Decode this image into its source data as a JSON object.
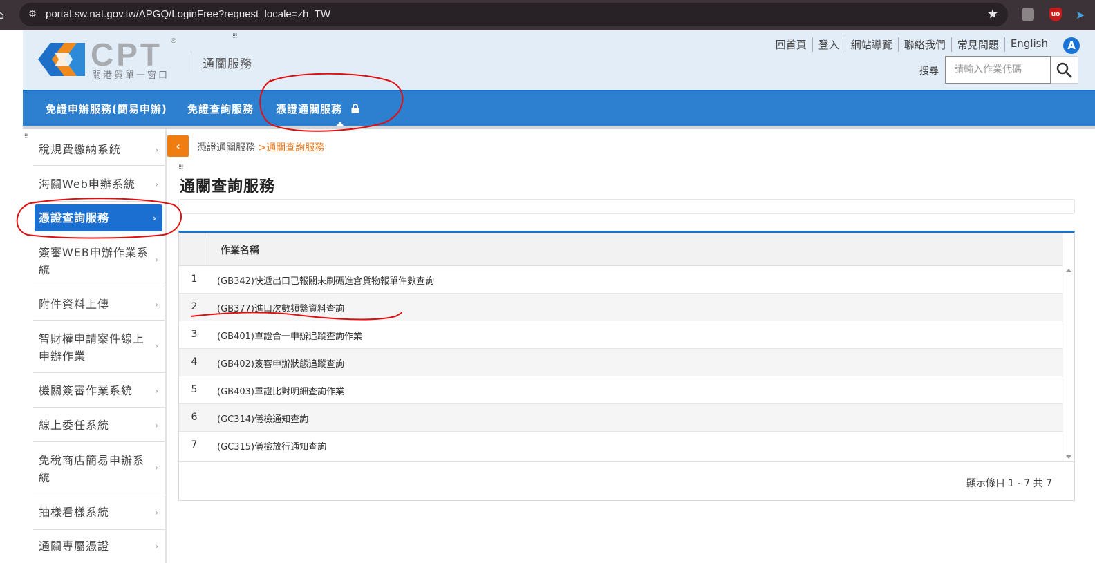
{
  "browser": {
    "url": "portal.sw.nat.gov.tw/APGQ/LoginFree?request_locale=zh_TW"
  },
  "header": {
    "logo_text": "CPT",
    "logo_reg": "®",
    "logo_sub": "關港貿單一窗口",
    "service_title": "通關服務",
    "top_links": [
      "回首頁",
      "登入",
      "網站導覽",
      "聯絡我們",
      "常見問題",
      "English"
    ],
    "access_icon": "A",
    "search_label": "搜尋",
    "search_placeholder": "請輸入作業代碼"
  },
  "main_nav": {
    "items": [
      "免證申辦服務(簡易申辦)",
      "免證查詢服務",
      "憑證通關服務"
    ],
    "active_index": 2
  },
  "sidebar": {
    "items": [
      {
        "label": "稅規費繳納系統"
      },
      {
        "label": "海關Web申辦系統"
      },
      {
        "label": "憑證查詢服務",
        "active": true
      },
      {
        "label": "簽審WEB申辦作業系統"
      },
      {
        "label": "附件資料上傳"
      },
      {
        "label": "智財權申請案件線上申辦作業"
      },
      {
        "label": "機關簽審作業系統"
      },
      {
        "label": "線上委任系統"
      },
      {
        "label": "免稅商店簡易申辦系統"
      },
      {
        "label": "抽樣看樣系統"
      },
      {
        "label": "通關專屬憑證"
      }
    ]
  },
  "breadcrumb": {
    "parent": "憑證通關服務",
    "separator": ">",
    "current": "通關查詢服務"
  },
  "page_title": "通關查詢服務",
  "grid": {
    "column_header": "作業名稱",
    "rows": [
      {
        "no": "1",
        "name": "(GB342)快遞出口已報關未刷碼進倉貨物報單件數查詢"
      },
      {
        "no": "2",
        "name": "(GB377)進口次數頻繁資料查詢"
      },
      {
        "no": "3",
        "name": "(GB401)單證合一申辦追蹤查詢作業"
      },
      {
        "no": "4",
        "name": "(GB402)簽審申辦狀態追蹤查詢"
      },
      {
        "no": "5",
        "name": "(GB403)單證比對明細查詢作業"
      },
      {
        "no": "6",
        "name": "(GC314)儀檢通知查詢"
      },
      {
        "no": "7",
        "name": "(GC315)儀檢放行通知查詢"
      }
    ],
    "pager_info": "顯示條目 1 - 7 共 7"
  },
  "colors": {
    "nav_blue": "#2d7fd0",
    "active_blue": "#1a6fd0",
    "accent_orange": "#ef7d12",
    "annotation_red": "#e01010"
  }
}
